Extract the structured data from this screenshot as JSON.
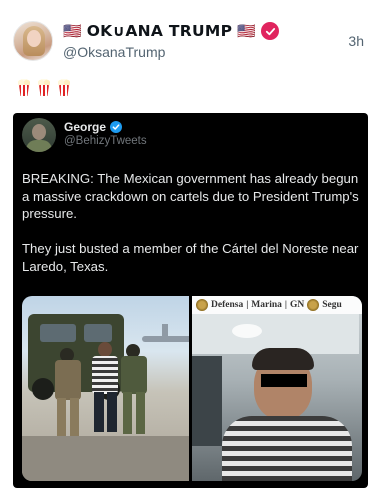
{
  "post": {
    "display_name": "OK∪ANA TRUMP",
    "flag_left": "🇺🇸",
    "flag_right": "🇺🇸",
    "handle": "@OksanaTrump",
    "time": "3h",
    "emojis": [
      "popcorn-icon",
      "popcorn-icon",
      "popcorn-icon"
    ]
  },
  "quote": {
    "name": "George",
    "handle": "@BehizyTweets",
    "paragraphs": [
      "BREAKING: The Mexican government has already begun a massive crackdown on cartels due to President Trump's pressure.",
      "They just busted a member of the Cártel del Noreste near Laredo, Texas."
    ],
    "media": {
      "left_image": "soldiers-arrest-photo",
      "right_image": "detained-man-in-vehicle-photo",
      "ribbon_labels": [
        "Defensa",
        "Marina",
        "|",
        "GN",
        "Segu"
      ]
    }
  },
  "colors": {
    "verified_pink": "#e0245e",
    "verified_blue": "#1d9bf0",
    "quote_background": "#000000"
  }
}
